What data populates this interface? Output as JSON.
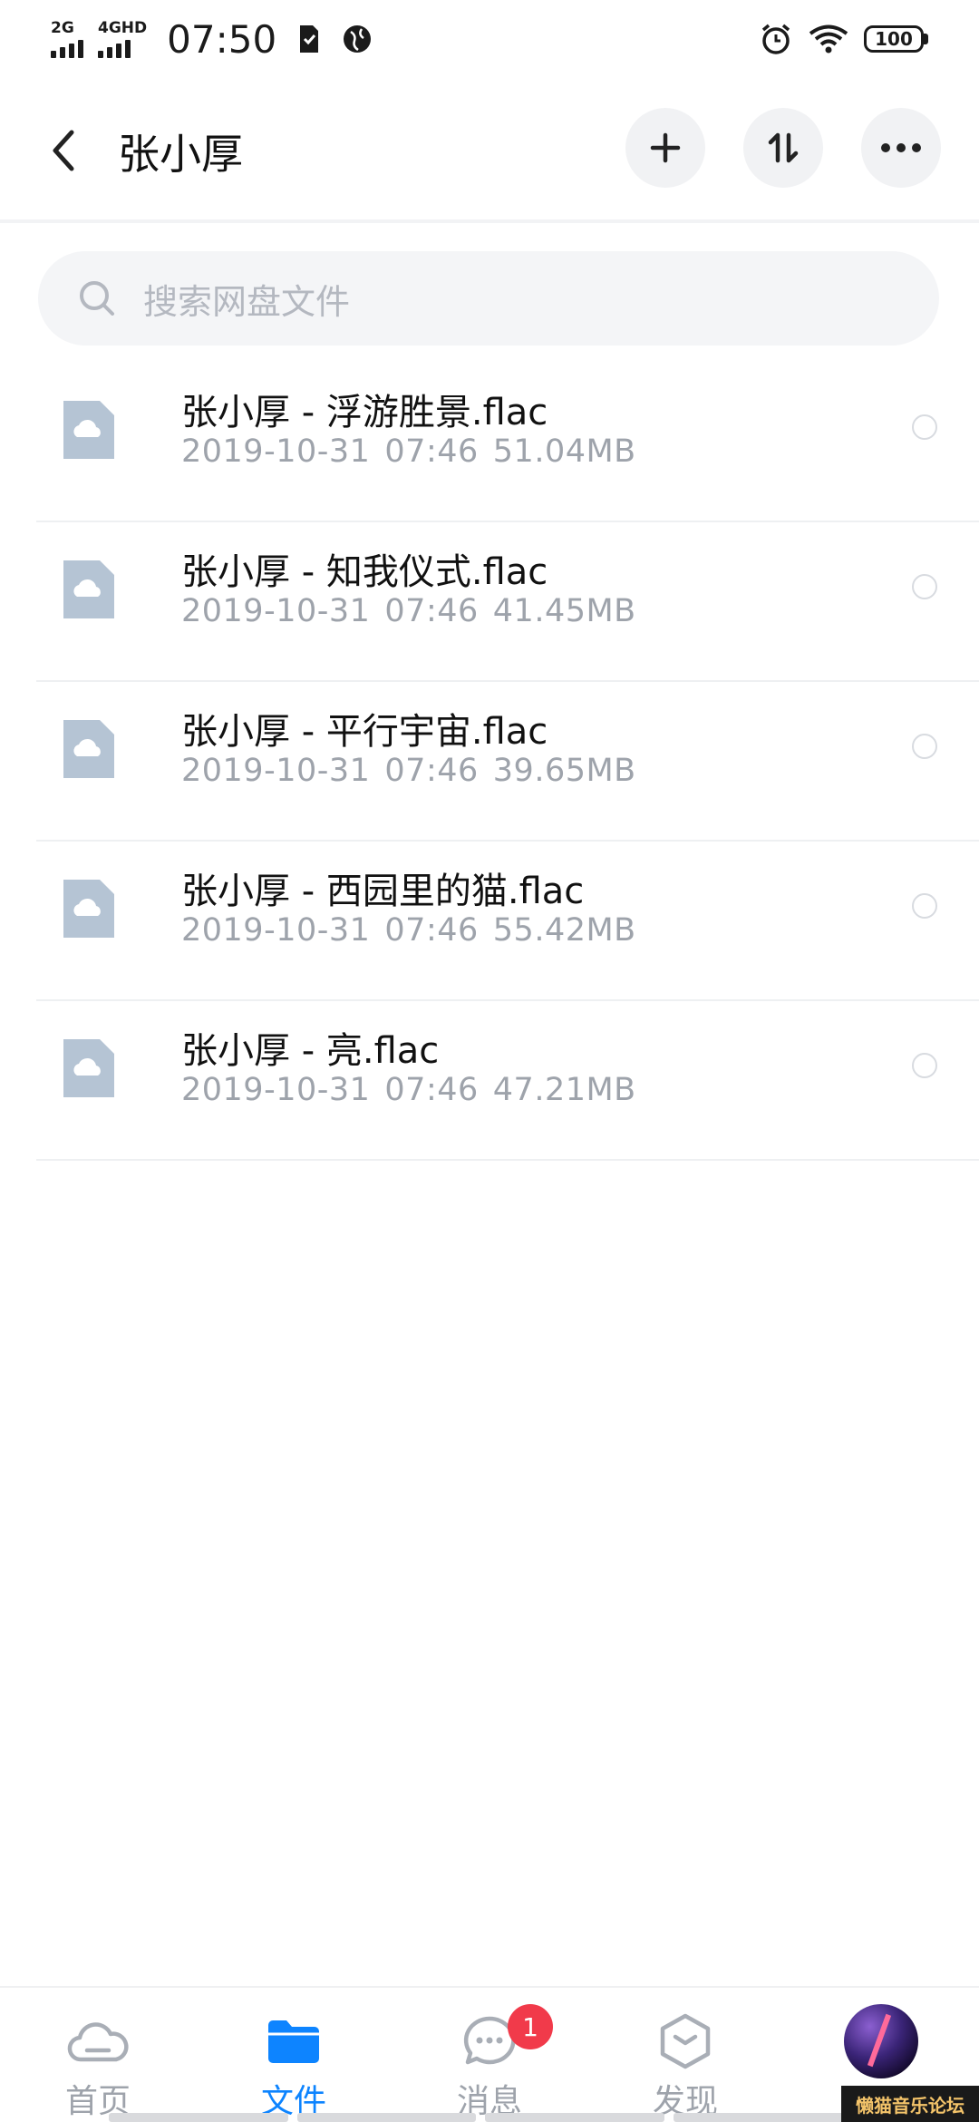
{
  "status_bar": {
    "signal1_label": "2G",
    "signal2_label": "4GHD",
    "time": "07:50",
    "battery": "100"
  },
  "header": {
    "title": "张小厚",
    "actions": [
      "plus-icon",
      "sort-icon",
      "more-icon"
    ]
  },
  "search": {
    "placeholder": "搜索网盘文件"
  },
  "files": [
    {
      "name": "张小厚 - 浮游胜景.flac",
      "date": "2019-10-31",
      "time": "07:46",
      "size": "51.04MB"
    },
    {
      "name": "张小厚 - 知我仪式.flac",
      "date": "2019-10-31",
      "time": "07:46",
      "size": "41.45MB"
    },
    {
      "name": "张小厚 - 平行宇宙.flac",
      "date": "2019-10-31",
      "time": "07:46",
      "size": "39.65MB"
    },
    {
      "name": "张小厚 - 西园里的猫.flac",
      "date": "2019-10-31",
      "time": "07:46",
      "size": "55.42MB"
    },
    {
      "name": "张小厚 - 亮.flac",
      "date": "2019-10-31",
      "time": "07:46",
      "size": "47.21MB"
    }
  ],
  "nav": {
    "home": "首页",
    "files": "文件",
    "messages": "消息",
    "messages_badge": "1",
    "discover": "发现"
  },
  "watermark": "懒猫音乐论坛",
  "colors": {
    "accent": "#0d84ff",
    "badge": "#f13a4a",
    "file_icon": "#b5c4d4"
  }
}
